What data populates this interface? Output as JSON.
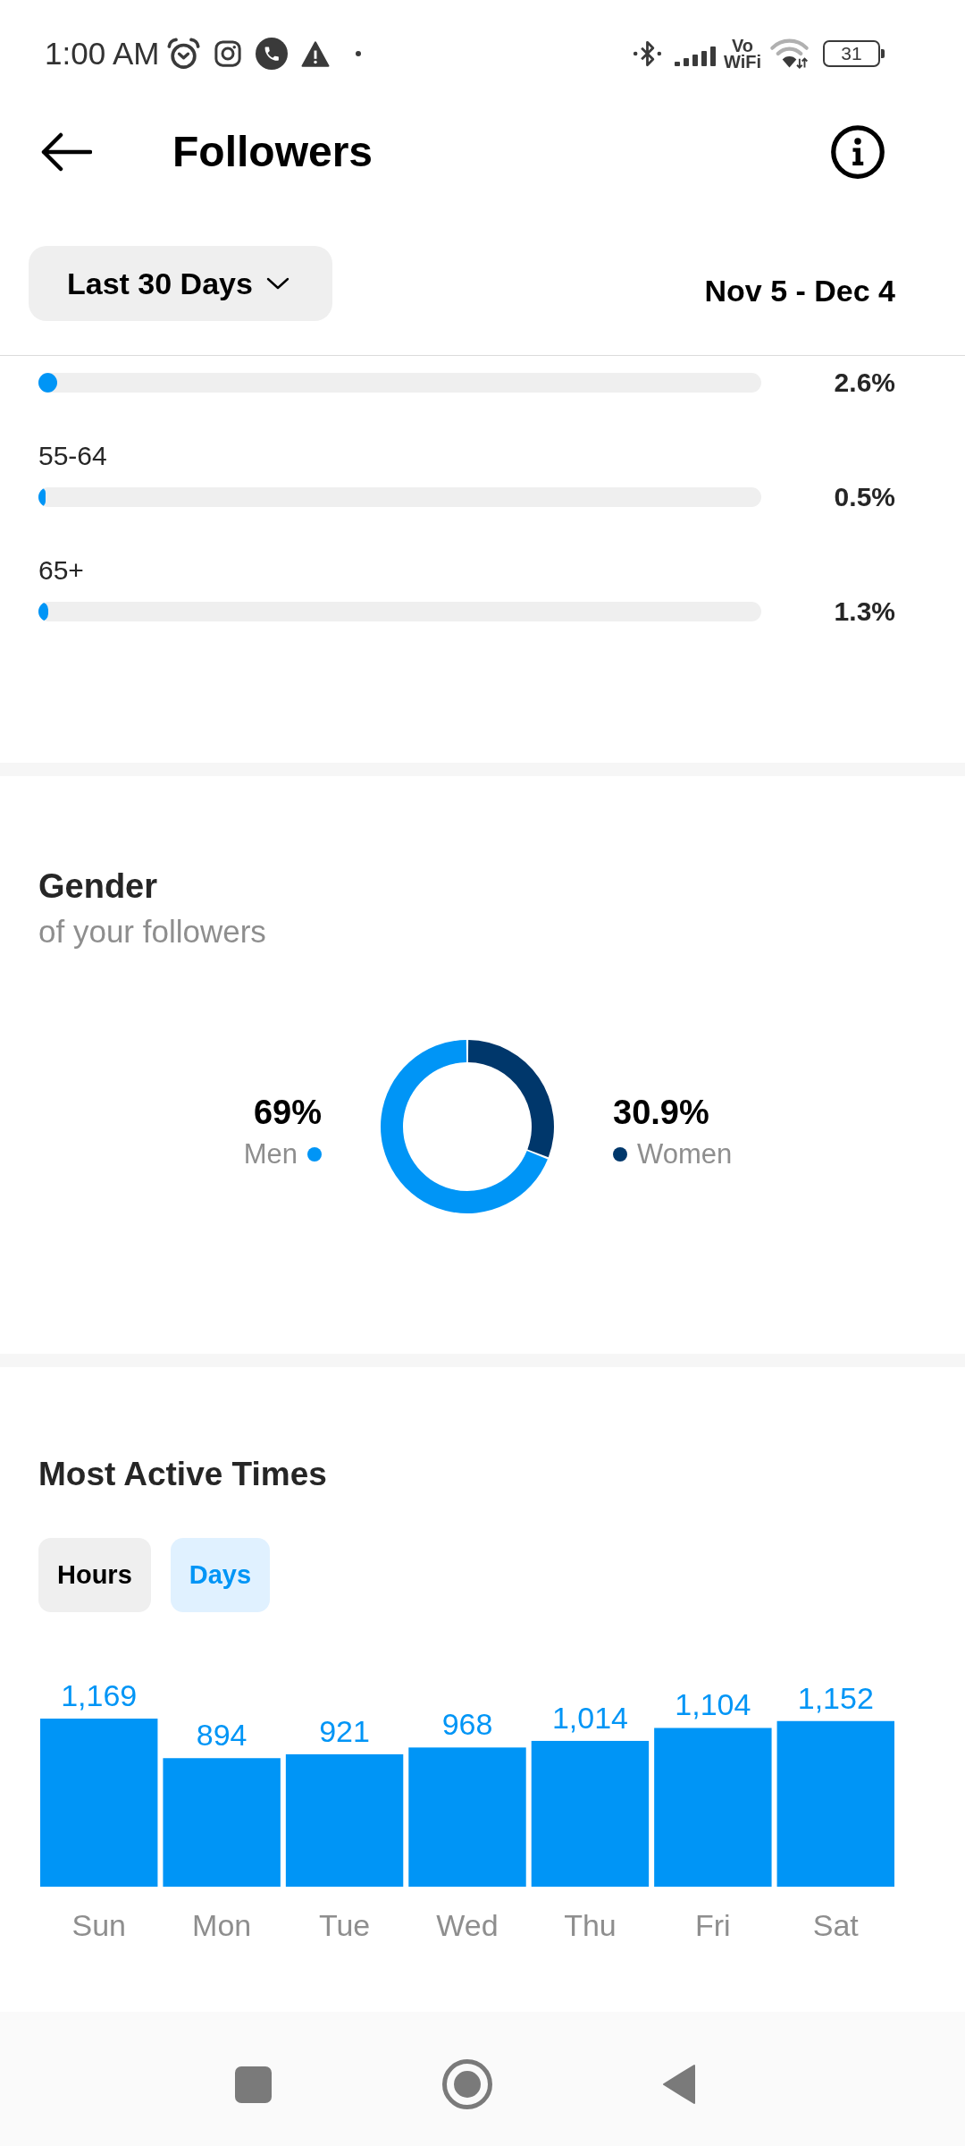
{
  "status_bar": {
    "time": "1:00 AM",
    "wifi_calling": "Vo WiFi",
    "battery": "31"
  },
  "header": {
    "title": "Followers"
  },
  "filter": {
    "period": "Last 30 Days",
    "range": "Nov 5 - Dec 4"
  },
  "age_ranges": [
    {
      "percent": "2.6%",
      "level": 0.026
    },
    {
      "label": "55-64",
      "percent": "0.5%",
      "level": 0.005
    },
    {
      "label": "65+",
      "percent": "1.3%",
      "level": 0.013
    }
  ],
  "gender": {
    "title": "Gender",
    "subtitle": "of your followers",
    "legend": [
      {
        "value": "69%",
        "label": "Men",
        "color": "#0095f6"
      },
      {
        "value": "30.9%",
        "label": "Women",
        "color": "#00376b"
      }
    ],
    "chart_data": {
      "type": "donut",
      "values": [
        69,
        30.9
      ]
    }
  },
  "active_times": {
    "title": "Most Active Times",
    "tabs": [
      {
        "label": "Hours",
        "selected": false
      },
      {
        "label": "Days",
        "selected": true
      }
    ],
    "chart_data": {
      "type": "bar",
      "categories": [
        "Sun",
        "Mon",
        "Tue",
        "Wed",
        "Thu",
        "Fri",
        "Sat"
      ],
      "values": [
        1169,
        894,
        921,
        968,
        1014,
        1104,
        1152
      ],
      "value_labels": [
        "1,169",
        "894",
        "921",
        "968",
        "1,014",
        "1,104",
        "1,152"
      ]
    }
  }
}
